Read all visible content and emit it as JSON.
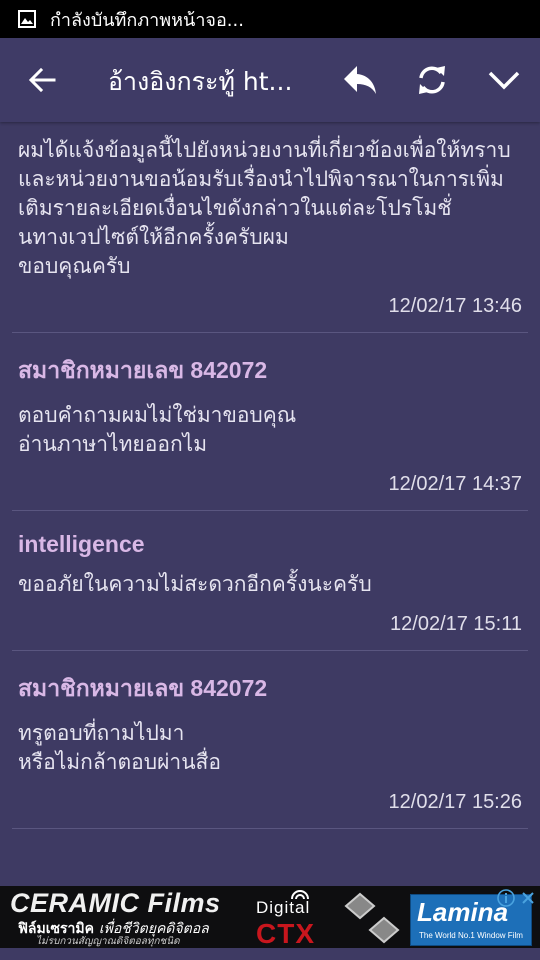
{
  "status_bar": {
    "notification_icon": "image-icon",
    "text": "กำลังบันทึกภาพหน้าจอ..."
  },
  "app_bar": {
    "title": "อ้างอิงกระทู้ ht...",
    "icons": [
      "arrow-back-icon",
      "reply-icon",
      "refresh-icon",
      "chevron-down-icon"
    ]
  },
  "posts": [
    {
      "author": "",
      "body": "ผมได้แจ้งข้อมูลนี้ไปยังหน่วยงานที่เกี่ยวข้องเพื่อให้ทราบ\nและหน่วยงานขอน้อมรับเรื่องนำไปพิจารณาในการเพิ่มเติมรายละเอียดเงื่อนไขดังกล่าวในแต่ละโปรโมชั่นทางเวปไซต์ให้อีกครั้งครับผม\nขอบคุณครับ",
      "time": "12/02/17 13:46"
    },
    {
      "author": "สมาชิกหมายเลข 842072",
      "body": "ตอบคำถามผมไม่ใช่มาขอบคุณ\nอ่านภาษาไทยออกไม",
      "time": "12/02/17 14:37"
    },
    {
      "author": "intelligence",
      "body": "ขออภัยในความไม่สะดวกอีกครั้งนะครับ",
      "time": "12/02/17 15:11"
    },
    {
      "author": "สมาชิกหมายเลข 842072",
      "body": "ทรูตอบที่ถามไปมา\nหรือไม่กล้าตอบผ่านสื่อ",
      "time": "12/02/17 15:26"
    }
  ],
  "ad": {
    "ceramic_title": "CERAMIC Films",
    "ceramic_sub_bold": "ฟิล์มเซรามิค",
    "ceramic_sub_italic": "เพื่อชีวิตยุคดิจิตอล",
    "ceramic_tag": "ไม่รบกวนสัญญาณดิจิตอลทุกชนิด",
    "digital": "Digital",
    "ctx": "CTX",
    "lamina": "Lamina",
    "lamina_tag": "The World No.1 Window Film",
    "info_icon": "info-icon",
    "close_icon": "close-icon"
  },
  "colors": {
    "background": "#3e3a63",
    "app_bar": "#3f3b66",
    "author": "#d9b8e6",
    "ctx_red": "#c8161d",
    "lamina_blue": "#1d6fb8"
  }
}
